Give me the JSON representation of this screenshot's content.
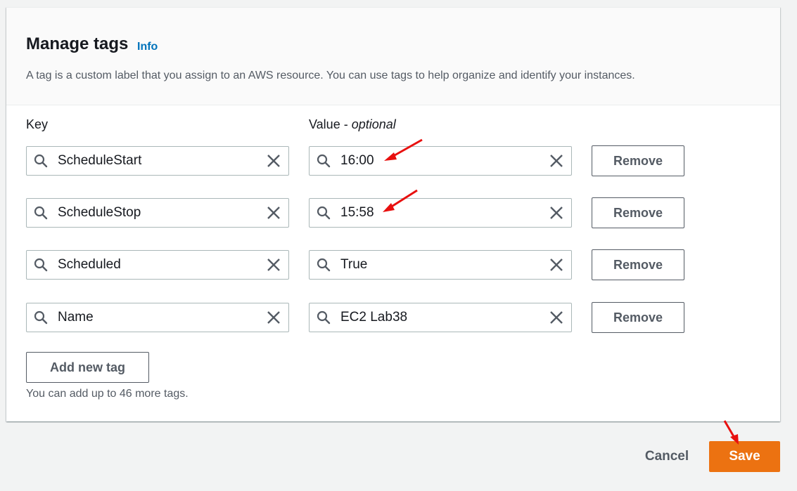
{
  "header": {
    "title": "Manage tags",
    "info_link": "Info",
    "description": "A tag is a custom label that you assign to an AWS resource. You can use tags to help organize and identify your instances."
  },
  "columns": {
    "key_label": "Key",
    "value_label": "Value",
    "value_suffix": "optional",
    "value_separator": " - "
  },
  "tags": [
    {
      "key": "ScheduleStart",
      "value": "16:00",
      "remove_label": "Remove"
    },
    {
      "key": "ScheduleStop",
      "value": "15:58",
      "remove_label": "Remove"
    },
    {
      "key": "Scheduled",
      "value": "True",
      "remove_label": "Remove"
    },
    {
      "key": "Name",
      "value": "EC2 Lab38",
      "remove_label": "Remove"
    }
  ],
  "add_button_label": "Add new tag",
  "limit_text": "You can add up to 46 more tags.",
  "footer": {
    "cancel_label": "Cancel",
    "save_label": "Save"
  },
  "icons": {
    "search": "search-icon",
    "clear": "close-icon",
    "annotation": "red-arrow-annotation"
  },
  "colors": {
    "primary_button": "#ec7211",
    "link": "#0073bb",
    "annotation_arrow": "#e8100f"
  }
}
